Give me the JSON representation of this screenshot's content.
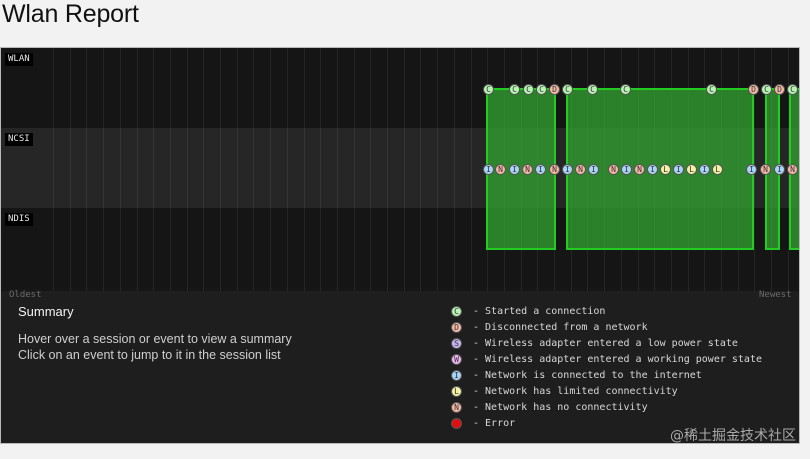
{
  "page": {
    "title": "Wlan Report"
  },
  "timeline": {
    "rows": [
      "WLAN",
      "NCSI",
      "NDIS"
    ],
    "axis": {
      "start": "Oldest",
      "end": "Newest"
    },
    "wlan_events": [
      "C",
      "C",
      "C",
      "C",
      "D",
      "C",
      "C",
      "C",
      "C",
      "D",
      "C",
      "D",
      "C"
    ],
    "ncsi_events": [
      "I",
      "N",
      "I",
      "N",
      "I",
      "N",
      "I",
      "N",
      "I",
      "N",
      "I",
      "N",
      "I",
      "L",
      "I",
      "L",
      "I",
      "L",
      "I",
      "N",
      "I",
      "N",
      "I",
      "N",
      "I"
    ]
  },
  "summary": {
    "title": "Summary",
    "lines": [
      "Hover over a session or event to view a summary",
      "Click on an event to jump to it in the session list"
    ]
  },
  "legend": [
    {
      "code": "C",
      "text": "- Started a connection",
      "color": "#b9f3b4"
    },
    {
      "code": "D",
      "text": "- Disconnected from a network",
      "color": "#f5b9a5"
    },
    {
      "code": "S",
      "text": "- Wireless adapter entered a low power state",
      "color": "#c8b4f0"
    },
    {
      "code": "W",
      "text": "- Wireless adapter entered a working power state",
      "color": "#f0b4f0"
    },
    {
      "code": "I",
      "text": "- Network is connected to the internet",
      "color": "#a9d4f7"
    },
    {
      "code": "L",
      "text": "- Network has limited connectivity",
      "color": "#f3f1a5"
    },
    {
      "code": "N",
      "text": "- Network has no connectivity",
      "color": "#f5b9a5"
    },
    {
      "code": "E",
      "text": "- Error",
      "color": "#e01010"
    }
  ],
  "watermark": "@稀土掘金技术社区"
}
